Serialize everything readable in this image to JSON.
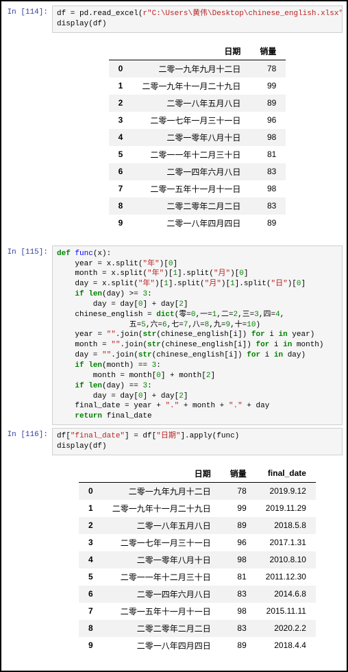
{
  "prompts": {
    "p114": "In [114]:",
    "p115": "In [115]:",
    "p116": "In [116]:"
  },
  "code114": {
    "l1a": "df = pd.read_excel(",
    "l1b": "r",
    "l1c": "\"C:\\Users\\黄伟\\Desktop\\chinese_english.xlsx\"",
    "l1d": ")",
    "l2": "display(df)"
  },
  "table1": {
    "headers": {
      "idx": "",
      "c0": "日期",
      "c1": "销量"
    },
    "rows": [
      {
        "idx": "0",
        "date": "二零一九年九月十二日",
        "val": "78"
      },
      {
        "idx": "1",
        "date": "二零一九年十一月二十九日",
        "val": "99"
      },
      {
        "idx": "2",
        "date": "二零一八年五月八日",
        "val": "89"
      },
      {
        "idx": "3",
        "date": "二零一七年一月三十一日",
        "val": "96"
      },
      {
        "idx": "4",
        "date": "二零一零年八月十日",
        "val": "98"
      },
      {
        "idx": "5",
        "date": "二零一一年十二月三十日",
        "val": "81"
      },
      {
        "idx": "6",
        "date": "二零一四年六月八日",
        "val": "83"
      },
      {
        "idx": "7",
        "date": "二零一五年十一月十一日",
        "val": "98"
      },
      {
        "idx": "8",
        "date": "二零二零年二月二日",
        "val": "83"
      },
      {
        "idx": "9",
        "date": "二零一八年四月四日",
        "val": "89"
      }
    ]
  },
  "code115": {
    "l1a": "def",
    "l1b": " ",
    "l1c": "func",
    "l1d": "(x):",
    "l2a": "    year = x.split(",
    "l2b": "\"年\"",
    "l2c": ")[",
    "l2d": "0",
    "l2e": "]",
    "l3a": "    month = x.split(",
    "l3b": "\"年\"",
    "l3c": ")[",
    "l3d": "1",
    "l3e": "].split(",
    "l3f": "\"月\"",
    "l3g": ")[",
    "l3h": "0",
    "l3i": "]",
    "l4a": "    day = x.split(",
    "l4b": "\"年\"",
    "l4c": ")[",
    "l4d": "1",
    "l4e": "].split(",
    "l4f": "\"月\"",
    "l4g": ")[",
    "l4h": "1",
    "l4i": "].split(",
    "l4j": "\"日\"",
    "l4k": ")[",
    "l4l": "0",
    "l4m": "]",
    "l5a": "    ",
    "l5b": "if",
    "l5c": " ",
    "l5d": "len",
    "l5e": "(day) >= ",
    "l5f": "3",
    "l5g": ":",
    "l6a": "        day = day[",
    "l6b": "0",
    "l6c": "] + day[",
    "l6d": "2",
    "l6e": "]",
    "l7a": "    chinese_english = ",
    "l7b": "dict",
    "l7c": "(零=",
    "l7d": "0",
    "l7e": ",一=",
    "l7f": "1",
    "l7g": ",二=",
    "l7h": "2",
    "l7i": ",三=",
    "l7j": "3",
    "l7k": ",四=",
    "l7l": "4",
    "l7m": ",",
    "l8a": "                五=",
    "l8b": "5",
    "l8c": ",六=",
    "l8d": "6",
    "l8e": ",七=",
    "l8f": "7",
    "l8g": ",八=",
    "l8h": "8",
    "l8i": ",九=",
    "l8j": "9",
    "l8k": ",十=",
    "l8l": "10",
    "l8m": ")",
    "l9a": "    year = ",
    "l9b": "\"\"",
    "l9c": ".join(",
    "l9d": "str",
    "l9e": "(chinese_english[i]) ",
    "l9f": "for",
    "l9g": " i ",
    "l9h": "in",
    "l9i": " year)",
    "l10a": "    month = ",
    "l10b": "\"\"",
    "l10c": ".join(",
    "l10d": "str",
    "l10e": "(chinese_english[i]) ",
    "l10f": "for",
    "l10g": " i ",
    "l10h": "in",
    "l10i": " month)",
    "l11a": "    day = ",
    "l11b": "\"\"",
    "l11c": ".join(",
    "l11d": "str",
    "l11e": "(chinese_english[i]) ",
    "l11f": "for",
    "l11g": " i ",
    "l11h": "in",
    "l11i": " day)",
    "l12a": "    ",
    "l12b": "if",
    "l12c": " ",
    "l12d": "len",
    "l12e": "(month) == ",
    "l12f": "3",
    "l12g": ":",
    "l13a": "        month = month[",
    "l13b": "0",
    "l13c": "] + month[",
    "l13d": "2",
    "l13e": "]",
    "l14a": "    ",
    "l14b": "if",
    "l14c": " ",
    "l14d": "len",
    "l14e": "(day) == ",
    "l14f": "3",
    "l14g": ":",
    "l15a": "        day = day[",
    "l15b": "0",
    "l15c": "] + day[",
    "l15d": "2",
    "l15e": "]",
    "l16a": "    final_date = year + ",
    "l16b": "\".\"",
    "l16c": " + month + ",
    "l16d": "\".\"",
    "l16e": " + day",
    "l17a": "    ",
    "l17b": "return",
    "l17c": " final_date"
  },
  "code116": {
    "l1a": "df[",
    "l1b": "\"final_date\"",
    "l1c": "] = df[",
    "l1d": "\"日期\"",
    "l1e": "].apply(func)",
    "l2": "display(df)"
  },
  "table2": {
    "headers": {
      "idx": "",
      "c0": "日期",
      "c1": "销量",
      "c2": "final_date"
    },
    "rows": [
      {
        "idx": "0",
        "date": "二零一九年九月十二日",
        "val": "78",
        "fd": "2019.9.12"
      },
      {
        "idx": "1",
        "date": "二零一九年十一月二十九日",
        "val": "99",
        "fd": "2019.11.29"
      },
      {
        "idx": "2",
        "date": "二零一八年五月八日",
        "val": "89",
        "fd": "2018.5.8"
      },
      {
        "idx": "3",
        "date": "二零一七年一月三十一日",
        "val": "96",
        "fd": "2017.1.31"
      },
      {
        "idx": "4",
        "date": "二零一零年八月十日",
        "val": "98",
        "fd": "2010.8.10"
      },
      {
        "idx": "5",
        "date": "二零一一年十二月三十日",
        "val": "81",
        "fd": "2011.12.30"
      },
      {
        "idx": "6",
        "date": "二零一四年六月八日",
        "val": "83",
        "fd": "2014.6.8"
      },
      {
        "idx": "7",
        "date": "二零一五年十一月十一日",
        "val": "98",
        "fd": "2015.11.11"
      },
      {
        "idx": "8",
        "date": "二零二零年二月二日",
        "val": "83",
        "fd": "2020.2.2"
      },
      {
        "idx": "9",
        "date": "二零一八年四月四日",
        "val": "89",
        "fd": "2018.4.4"
      }
    ]
  }
}
